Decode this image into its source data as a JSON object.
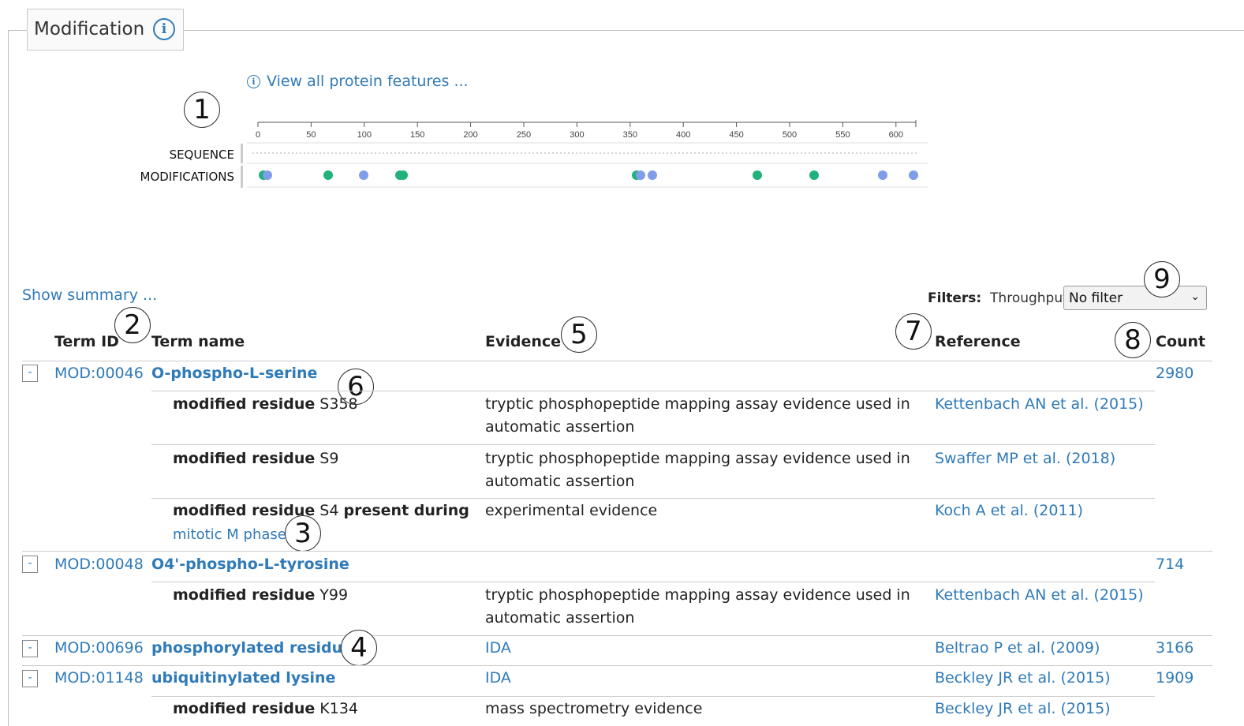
{
  "section": {
    "title": "Modification"
  },
  "viewer": {
    "link_text": "View all protein features ...",
    "ticks": [
      "0",
      "50",
      "100",
      "150",
      "200",
      "250",
      "300",
      "350",
      "400",
      "450",
      "500",
      "550",
      "600"
    ],
    "tracks": [
      "SEQUENCE",
      "MODIFICATIONS"
    ],
    "dot_colors": {
      "green": "#20b27a",
      "blue": "#7f9de9"
    }
  },
  "callouts": [
    "1",
    "2",
    "3",
    "4",
    "5",
    "6",
    "7",
    "8",
    "9"
  ],
  "table": {
    "show_summary": "Show summary ...",
    "filters_label": "Filters:",
    "filter_name": "Throughput",
    "filter_value": "No filter",
    "headers": {
      "term_id": "Term ID",
      "term_name": "Term name",
      "evidence": "Evidence",
      "reference": "Reference",
      "count": "Count"
    },
    "toggle": "-",
    "rows": [
      {
        "term_id": "MOD:00046",
        "term_name": "O-phospho-L-serine",
        "count": "2980",
        "details": [
          {
            "label": "modified residue",
            "value": "S358",
            "evidence": "tryptic phosphopeptide mapping assay evidence used in automatic assertion",
            "reference": "Kettenbach AN et al. (2015)"
          },
          {
            "label": "modified residue",
            "value": "S9",
            "evidence": "tryptic phosphopeptide mapping assay evidence used in automatic assertion",
            "reference": "Swaffer MP et al. (2018)"
          },
          {
            "label": "modified residue",
            "value": "S4",
            "extra": "present during",
            "extra_link": "mitotic M phase",
            "evidence": "experimental evidence",
            "reference": "Koch A et al. (2011)"
          }
        ]
      },
      {
        "term_id": "MOD:00048",
        "term_name": "O4'-phospho-L-tyrosine",
        "count": "714",
        "details": [
          {
            "label": "modified residue",
            "value": "Y99",
            "evidence": "tryptic phosphopeptide mapping assay evidence used in automatic assertion",
            "reference": "Kettenbach AN et al. (2015)"
          }
        ]
      },
      {
        "term_id": "MOD:00696",
        "term_name": "phosphorylated residue",
        "evidence": "IDA",
        "reference": "Beltrao P et al. (2009)",
        "count": "3166"
      },
      {
        "term_id": "MOD:01148",
        "term_name": "ubiquitinylated lysine",
        "evidence": "IDA",
        "reference": "Beckley JR et al. (2015)",
        "count": "1909",
        "details": [
          {
            "label": "modified residue",
            "value": "K134",
            "evidence": "mass spectrometry evidence",
            "reference": "Beckley JR et al. (2015)"
          }
        ]
      }
    ]
  }
}
